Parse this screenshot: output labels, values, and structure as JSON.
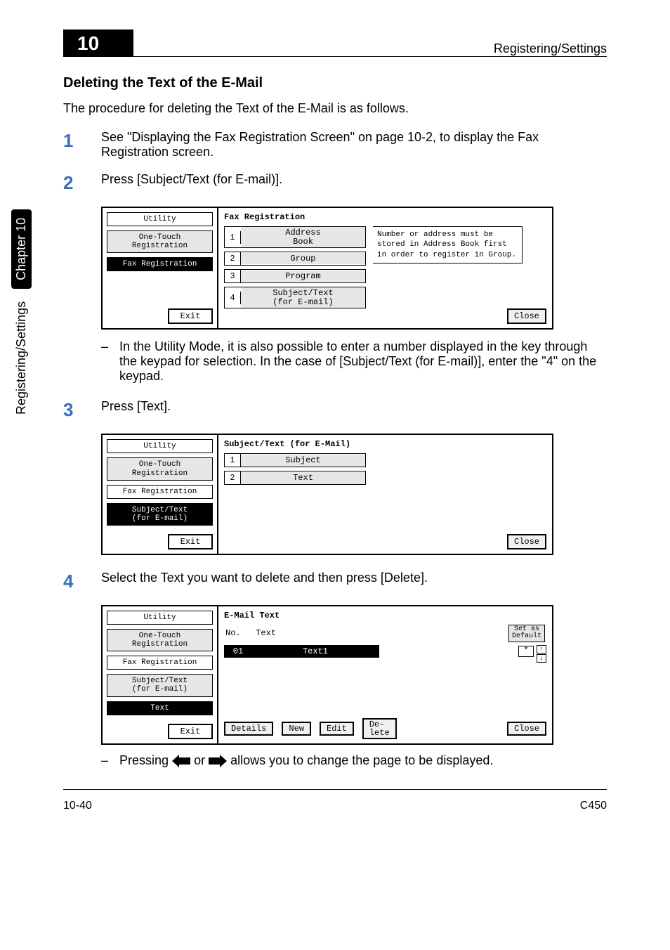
{
  "header": {
    "chapter_num": "10",
    "running_header": "Registering/Settings"
  },
  "side_tab": {
    "text": "Registering/Settings",
    "chapter": "Chapter 10"
  },
  "section": {
    "title": "Deleting the Text of the E-Mail",
    "intro": "The procedure for deleting the Text of the E-Mail is as follows."
  },
  "steps": {
    "s1": {
      "num": "1",
      "text": "See \"Displaying the Fax Registration Screen\" on page 10-2, to display the Fax Registration screen."
    },
    "s2": {
      "num": "2",
      "text": "Press [Subject/Text (for E-mail)].",
      "note": "In the Utility Mode, it is also possible to enter a number displayed in the key through the keypad for selection. In the case of [Subject/Text (for E-mail)], enter the \"4\" on the keypad."
    },
    "s3": {
      "num": "3",
      "text": "Press [Text]."
    },
    "s4": {
      "num": "4",
      "text": "Select the Text you want to delete and then press [Delete].",
      "tail_a": "Pressing ",
      "tail_b": " or ",
      "tail_c": " allows you to change the page to be displayed."
    }
  },
  "lcd1": {
    "left": {
      "utility": "Utility",
      "onetouch": "One-Touch\nRegistration",
      "faxreg": "Fax Registration",
      "exit": "Exit"
    },
    "title": "Fax Registration",
    "items": [
      {
        "n": "1",
        "l": "Address\nBook"
      },
      {
        "n": "2",
        "l": "Group"
      },
      {
        "n": "3",
        "l": "Program"
      },
      {
        "n": "4",
        "l": "Subject/Text\n(for E-mail)"
      }
    ],
    "msg": "Number or address must be stored in Address Book first in order to register in Group.",
    "close": "Close"
  },
  "lcd2": {
    "left": {
      "utility": "Utility",
      "onetouch": "One-Touch\nRegistration",
      "faxreg": "Fax Registration",
      "subj": "Subject/Text\n(for E-mail)",
      "exit": "Exit"
    },
    "title": "Subject/Text (for E-Mail)",
    "items": [
      {
        "n": "1",
        "l": "Subject"
      },
      {
        "n": "2",
        "l": "Text"
      }
    ],
    "close": "Close"
  },
  "lcd3": {
    "left": {
      "utility": "Utility",
      "onetouch": "One-Touch\nRegistration",
      "faxreg": "Fax Registration",
      "subj": "Subject/Text\n(for E-mail)",
      "text": "Text",
      "exit": "Exit"
    },
    "title": "E-Mail Text",
    "col_no": "No.",
    "col_text": "Text",
    "setas": "Set as\nDefault",
    "row_no": "01",
    "row_text": "Text1",
    "star": "*",
    "scroll_up": "↑",
    "scroll_dn": "↓",
    "btn_details": "Details",
    "btn_new": "New",
    "btn_edit": "Edit",
    "btn_delete": "De-\nlete",
    "btn_close": "Close"
  },
  "footer": {
    "left": "10-40",
    "right": "C450"
  }
}
